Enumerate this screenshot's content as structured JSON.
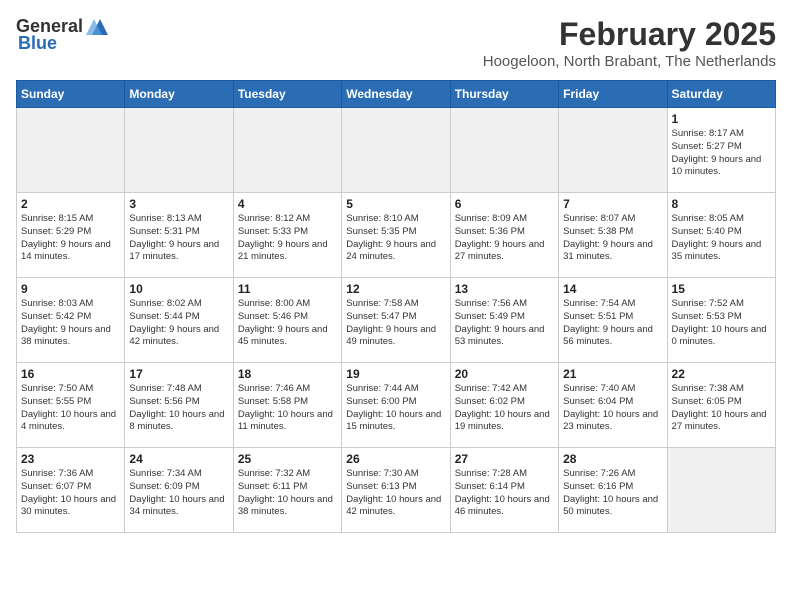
{
  "header": {
    "logo_general": "General",
    "logo_blue": "Blue",
    "month_year": "February 2025",
    "location": "Hoogeloon, North Brabant, The Netherlands"
  },
  "weekdays": [
    "Sunday",
    "Monday",
    "Tuesday",
    "Wednesday",
    "Thursday",
    "Friday",
    "Saturday"
  ],
  "weeks": [
    [
      {
        "day": "",
        "info": ""
      },
      {
        "day": "",
        "info": ""
      },
      {
        "day": "",
        "info": ""
      },
      {
        "day": "",
        "info": ""
      },
      {
        "day": "",
        "info": ""
      },
      {
        "day": "",
        "info": ""
      },
      {
        "day": "1",
        "info": "Sunrise: 8:17 AM\nSunset: 5:27 PM\nDaylight: 9 hours and 10 minutes."
      }
    ],
    [
      {
        "day": "2",
        "info": "Sunrise: 8:15 AM\nSunset: 5:29 PM\nDaylight: 9 hours and 14 minutes."
      },
      {
        "day": "3",
        "info": "Sunrise: 8:13 AM\nSunset: 5:31 PM\nDaylight: 9 hours and 17 minutes."
      },
      {
        "day": "4",
        "info": "Sunrise: 8:12 AM\nSunset: 5:33 PM\nDaylight: 9 hours and 21 minutes."
      },
      {
        "day": "5",
        "info": "Sunrise: 8:10 AM\nSunset: 5:35 PM\nDaylight: 9 hours and 24 minutes."
      },
      {
        "day": "6",
        "info": "Sunrise: 8:09 AM\nSunset: 5:36 PM\nDaylight: 9 hours and 27 minutes."
      },
      {
        "day": "7",
        "info": "Sunrise: 8:07 AM\nSunset: 5:38 PM\nDaylight: 9 hours and 31 minutes."
      },
      {
        "day": "8",
        "info": "Sunrise: 8:05 AM\nSunset: 5:40 PM\nDaylight: 9 hours and 35 minutes."
      }
    ],
    [
      {
        "day": "9",
        "info": "Sunrise: 8:03 AM\nSunset: 5:42 PM\nDaylight: 9 hours and 38 minutes."
      },
      {
        "day": "10",
        "info": "Sunrise: 8:02 AM\nSunset: 5:44 PM\nDaylight: 9 hours and 42 minutes."
      },
      {
        "day": "11",
        "info": "Sunrise: 8:00 AM\nSunset: 5:46 PM\nDaylight: 9 hours and 45 minutes."
      },
      {
        "day": "12",
        "info": "Sunrise: 7:58 AM\nSunset: 5:47 PM\nDaylight: 9 hours and 49 minutes."
      },
      {
        "day": "13",
        "info": "Sunrise: 7:56 AM\nSunset: 5:49 PM\nDaylight: 9 hours and 53 minutes."
      },
      {
        "day": "14",
        "info": "Sunrise: 7:54 AM\nSunset: 5:51 PM\nDaylight: 9 hours and 56 minutes."
      },
      {
        "day": "15",
        "info": "Sunrise: 7:52 AM\nSunset: 5:53 PM\nDaylight: 10 hours and 0 minutes."
      }
    ],
    [
      {
        "day": "16",
        "info": "Sunrise: 7:50 AM\nSunset: 5:55 PM\nDaylight: 10 hours and 4 minutes."
      },
      {
        "day": "17",
        "info": "Sunrise: 7:48 AM\nSunset: 5:56 PM\nDaylight: 10 hours and 8 minutes."
      },
      {
        "day": "18",
        "info": "Sunrise: 7:46 AM\nSunset: 5:58 PM\nDaylight: 10 hours and 11 minutes."
      },
      {
        "day": "19",
        "info": "Sunrise: 7:44 AM\nSunset: 6:00 PM\nDaylight: 10 hours and 15 minutes."
      },
      {
        "day": "20",
        "info": "Sunrise: 7:42 AM\nSunset: 6:02 PM\nDaylight: 10 hours and 19 minutes."
      },
      {
        "day": "21",
        "info": "Sunrise: 7:40 AM\nSunset: 6:04 PM\nDaylight: 10 hours and 23 minutes."
      },
      {
        "day": "22",
        "info": "Sunrise: 7:38 AM\nSunset: 6:05 PM\nDaylight: 10 hours and 27 minutes."
      }
    ],
    [
      {
        "day": "23",
        "info": "Sunrise: 7:36 AM\nSunset: 6:07 PM\nDaylight: 10 hours and 30 minutes."
      },
      {
        "day": "24",
        "info": "Sunrise: 7:34 AM\nSunset: 6:09 PM\nDaylight: 10 hours and 34 minutes."
      },
      {
        "day": "25",
        "info": "Sunrise: 7:32 AM\nSunset: 6:11 PM\nDaylight: 10 hours and 38 minutes."
      },
      {
        "day": "26",
        "info": "Sunrise: 7:30 AM\nSunset: 6:13 PM\nDaylight: 10 hours and 42 minutes."
      },
      {
        "day": "27",
        "info": "Sunrise: 7:28 AM\nSunset: 6:14 PM\nDaylight: 10 hours and 46 minutes."
      },
      {
        "day": "28",
        "info": "Sunrise: 7:26 AM\nSunset: 6:16 PM\nDaylight: 10 hours and 50 minutes."
      },
      {
        "day": "",
        "info": ""
      }
    ]
  ]
}
